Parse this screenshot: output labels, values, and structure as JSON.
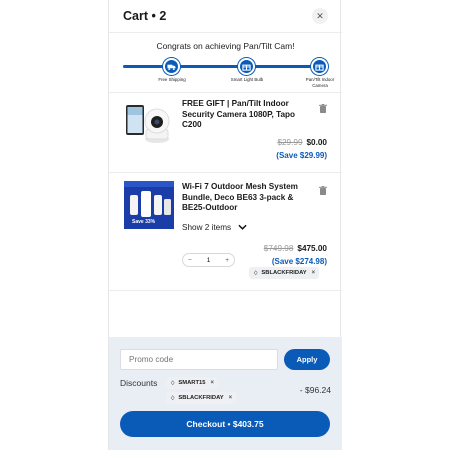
{
  "header": {
    "title": "Cart • 2",
    "close_label": "✕"
  },
  "progress": {
    "message": "Congrats on achieving Pan/Tilt Cam!",
    "milestones": [
      {
        "label": "Free Shipping",
        "icon": "truck-icon"
      },
      {
        "label": "Smart Light Bulb",
        "icon": "gift-icon"
      },
      {
        "label": "Pan/Tilt Indoor Camera",
        "icon": "gift-icon"
      }
    ],
    "fill_percent": 100
  },
  "items": [
    {
      "name": "FREE GIFT | Pan/Tilt Indoor Security Camera 1080P, Tapo C200",
      "old_price": "$29.99",
      "new_price": "$0.00",
      "save": "(Save $29.99)"
    },
    {
      "name": "Wi-Fi 7 Outdoor Mesh System Bundle, Deco BE63 3-pack & BE25-Outdoor",
      "show_items": "Show 2 items",
      "old_price": "$749.98",
      "new_price": "$475.00",
      "save": "(Save $274.98)",
      "quantity": "1",
      "minus": "−",
      "plus": "+",
      "coupon": "SBLACKFRIDAY",
      "img_badge": "Save 33%"
    }
  ],
  "footer": {
    "promo_placeholder": "Promo code",
    "apply_label": "Apply",
    "discounts_label": "Discounts",
    "discount_codes": [
      "SMART15",
      "SBLACKFRIDAY"
    ],
    "discount_amount": "- $96.24",
    "checkout_label": "Checkout • $403.75"
  },
  "colors": {
    "accent": "#0a5bb8",
    "footer_bg": "#e9eef5"
  }
}
